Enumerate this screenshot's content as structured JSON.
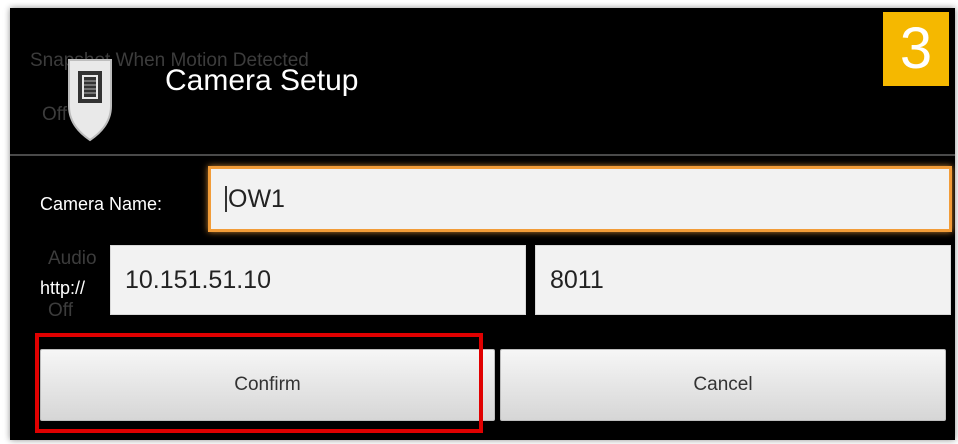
{
  "background_text": {
    "motion_line": "Snapshot When Motion Detected",
    "motion_value": "Off",
    "audio_line": "Audio",
    "audio_value": "Off"
  },
  "dialog": {
    "title": "Camera Setup",
    "icon": "shield-icon"
  },
  "step_badge": "3",
  "form": {
    "camera_name_label": "Camera Name:",
    "camera_name_value": "OW1",
    "protocol_label": "http://",
    "ip_value": "10.151.51.10",
    "port_value": "8011"
  },
  "buttons": {
    "confirm_label": "Confirm",
    "cancel_label": "Cancel"
  },
  "colors": {
    "dialog_background": "#000000",
    "badge": "#f5b800",
    "focus_border": "#f29c38",
    "highlight_border": "#e00000",
    "input_background": "#f2f2f2"
  }
}
